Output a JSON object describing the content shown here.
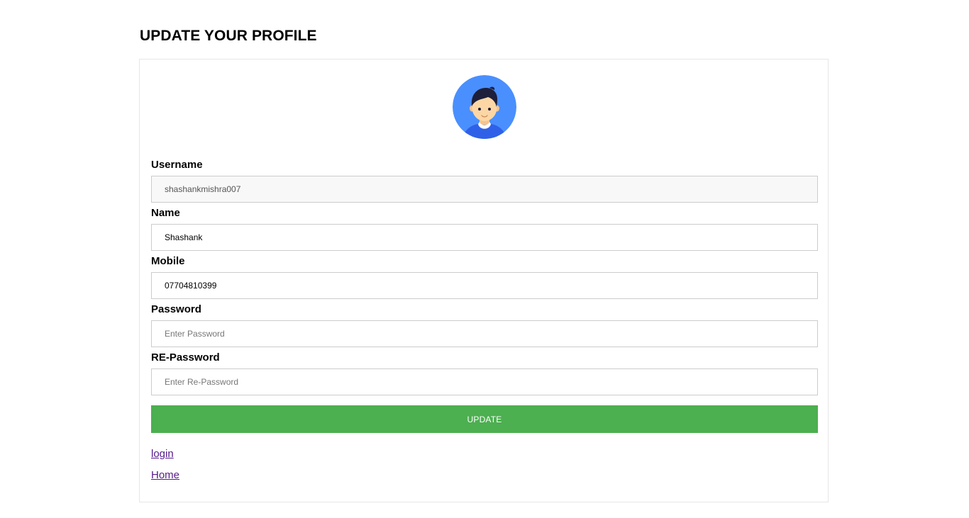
{
  "page": {
    "title": "UPDATE YOUR PROFILE"
  },
  "avatar": {
    "icon": "user-avatar-icon",
    "colors": {
      "background": "#4a8ffe",
      "hair": "#1e1f3a",
      "skin": "#fcd7a5",
      "shirt": "#2f61e8"
    }
  },
  "form": {
    "username": {
      "label": "Username",
      "value": "shashankmishra007",
      "readonly": true
    },
    "name": {
      "label": "Name",
      "value": "Shashank"
    },
    "mobile": {
      "label": "Mobile",
      "value": "07704810399"
    },
    "password": {
      "label": "Password",
      "value": "",
      "placeholder": "Enter Password"
    },
    "repassword": {
      "label": "RE-Password",
      "value": "",
      "placeholder": "Enter Re-Password"
    },
    "submit_label": "UPDATE"
  },
  "links": {
    "login": "login",
    "home": "Home"
  },
  "colors": {
    "button": "#4caf50",
    "link_visited": "#551a8b",
    "card_border": "#e6e6e6"
  }
}
